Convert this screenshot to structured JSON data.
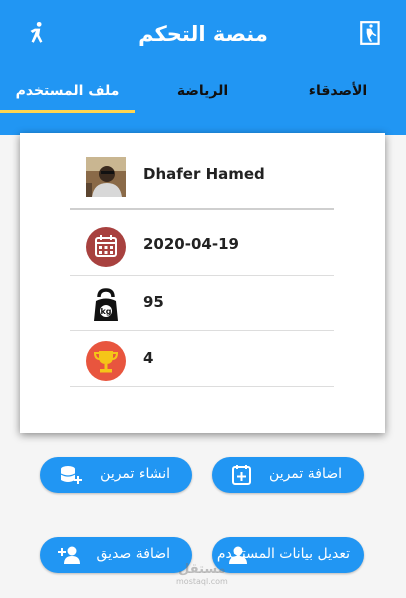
{
  "appbar": {
    "title": "منصة التحكم",
    "left_icon": "runner-icon",
    "right_icon": "exit-door-icon"
  },
  "tabs": [
    {
      "label": "ملف المستخدم",
      "active": true
    },
    {
      "label": "الرياضة",
      "active": false
    },
    {
      "label": "الأصدقاء",
      "active": false
    }
  ],
  "profile": {
    "name": "Dhafer Hamed",
    "date": "2020-04-19",
    "weight": "95",
    "trophies": "4",
    "icons": [
      "avatar-photo",
      "calendar-icon",
      "kettlebell-kg-icon",
      "trophy-icon"
    ]
  },
  "buttons": {
    "add_workout": "اضافة تمرين",
    "create_workout": "انشاء تمرين",
    "edit_user_data": "تعديل بيانات المستخدم",
    "add_friend": "اضافة صديق"
  },
  "watermark": {
    "text": "مستقل",
    "sub": "mostaql.com"
  },
  "colors": {
    "primary": "#2196f3",
    "tab_indicator": "#ffd54f",
    "calendar_bg": "#a8413f",
    "trophy_bg": "#e8553e"
  }
}
